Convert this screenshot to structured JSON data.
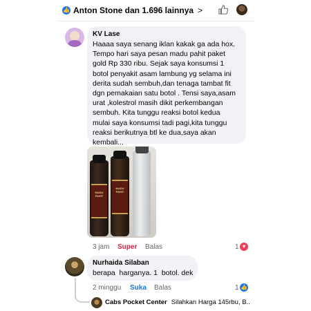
{
  "reactions": {
    "summary": "Anton Stone dan 1.696 lainnya",
    "like_glyph": "👍",
    "chevron": ">"
  },
  "comment1": {
    "author": "KV Lase",
    "text": "Haaaa saya senang iklan kakak ga ada hox.\nTempo hari saya pesan madu pahit paket\ngold Rp 330 ribu. Sejak saya konsumsi 1\nbotol penyakit asam lambung yg selama ini\nderita sudah sembuh,dan tenaga tambat fit\ndgn pemakaian satu botol . Tensi saya,asam\nurat ,kolestrol masih dikit perkembangan\nsembuh. Kita tunggu reaksi botol kedua\nmulai saya konsumsi tadi pagi,kita tunggu\nreaksi berikutnya btl ke dua,saya akan\nkembali...",
    "bottle_label": "MADU PAHIT",
    "time": "3 jam",
    "reaction": "Super",
    "reply": "Balas",
    "count": "1",
    "heart_glyph": "♥",
    "colors": {
      "reaction": "#e41e3f",
      "badge": "#f33e58"
    }
  },
  "comment2": {
    "author": "Nurhaida Silaban",
    "text": "berapa  harganya. 1  botol. dek",
    "time": "2 minggu",
    "reaction": "Suka",
    "reply": "Balas",
    "count": "1",
    "like_glyph": "👍",
    "colors": {
      "reaction": "#1877f2"
    }
  },
  "reply3": {
    "author": "Cabs Pocket Center",
    "text": "Silahkan Harga 145rbu, B..."
  }
}
